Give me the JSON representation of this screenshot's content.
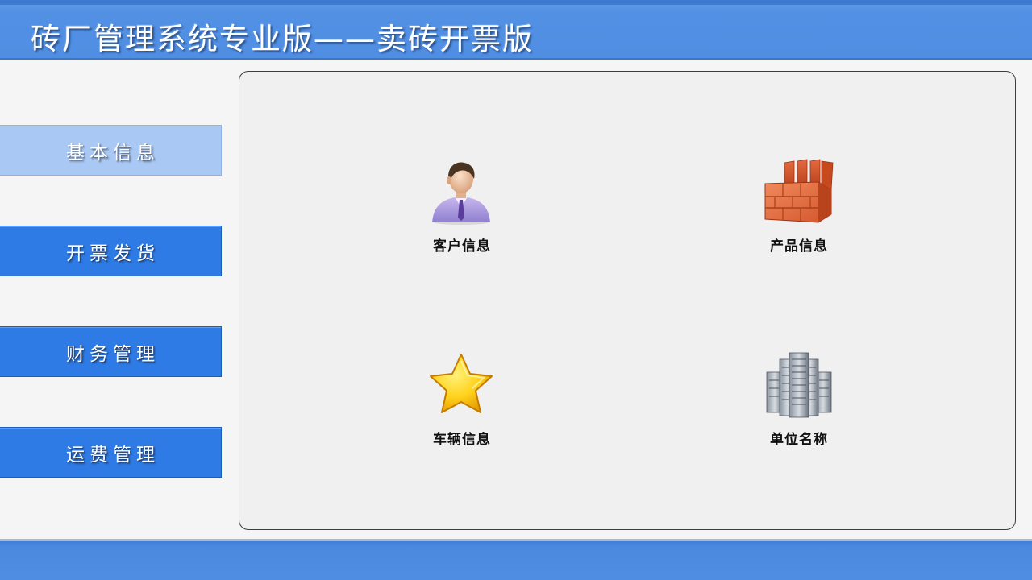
{
  "header": {
    "title": "砖厂管理系统专业版——卖砖开票版"
  },
  "sidebar": {
    "items": [
      {
        "label": "基本信息",
        "active": true
      },
      {
        "label": "开票发货",
        "active": false
      },
      {
        "label": "财务管理",
        "active": false
      },
      {
        "label": "运费管理",
        "active": false
      }
    ]
  },
  "main": {
    "tiles": [
      {
        "label": "客户信息",
        "icon": "customer-person-icon"
      },
      {
        "label": "产品信息",
        "icon": "brick-stack-icon"
      },
      {
        "label": "车辆信息",
        "icon": "star-icon"
      },
      {
        "label": "单位名称",
        "icon": "office-buildings-icon"
      }
    ]
  },
  "colors": {
    "header": "#4f8ee2",
    "nav_button": "#2e7be6",
    "nav_button_active": "#a9c8f3",
    "panel_background": "#f1f0f1",
    "page_background": "#f6f5f6"
  }
}
